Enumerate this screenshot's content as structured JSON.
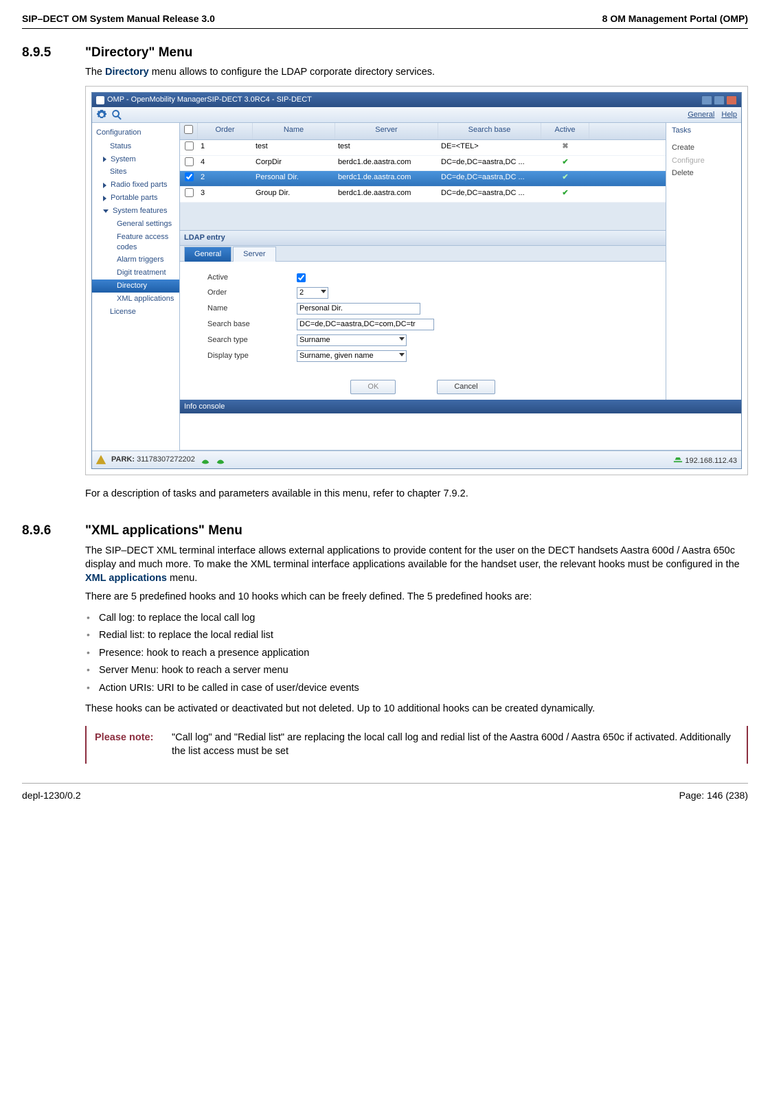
{
  "header": {
    "left": "SIP–DECT OM System Manual Release 3.0",
    "right": "8 OM Management Portal (OMP)"
  },
  "sec1": {
    "num": "8.9.5",
    "title": "\"Directory\" Menu",
    "intro_pre": "The ",
    "intro_bold": "Directory",
    "intro_post": " menu allows to configure the LDAP corporate directory services.",
    "after": "For a description of tasks and parameters available in this menu, refer to chapter 7.9.2."
  },
  "omp": {
    "title": "OMP - OpenMobility ManagerSIP-DECT 3.0RC4 - SIP-DECT",
    "toolbar": {
      "general": "General",
      "help": "Help"
    },
    "sidebar": {
      "root": "Configuration",
      "items": [
        "Status",
        "System",
        "Sites",
        "Radio fixed parts",
        "Portable parts",
        "System features"
      ],
      "features": [
        "General settings",
        "Feature access codes",
        "Alarm triggers",
        "Digit treatment",
        "Directory",
        "XML applications"
      ],
      "last": "License"
    },
    "columns": {
      "order": "Order",
      "name": "Name",
      "server": "Server",
      "searchbase": "Search base",
      "active": "Active"
    },
    "rows": [
      {
        "chk": false,
        "order": "1",
        "name": "test",
        "server": "test",
        "sb": "DE=<TEL>",
        "active": "x"
      },
      {
        "chk": false,
        "order": "4",
        "name": "CorpDir",
        "server": "berdc1.de.aastra.com",
        "sb": "DC=de,DC=aastra,DC ...",
        "active": "✓"
      },
      {
        "chk": true,
        "order": "2",
        "name": "Personal Dir.",
        "server": "berdc1.de.aastra.com",
        "sb": "DC=de,DC=aastra,DC ...",
        "active": "✓",
        "selected": true
      },
      {
        "chk": false,
        "order": "3",
        "name": "Group Dir.",
        "server": "berdc1.de.aastra.com",
        "sb": "DC=de,DC=aastra,DC ...",
        "active": "✓"
      }
    ],
    "tasks": {
      "title": "Tasks",
      "create": "Create",
      "configure": "Configure",
      "delete": "Delete"
    },
    "ldap": {
      "heading": "LDAP entry",
      "tabs": {
        "general": "General",
        "server": "Server"
      },
      "labels": {
        "active": "Active",
        "order": "Order",
        "name": "Name",
        "searchbase": "Search base",
        "searchtype": "Search type",
        "displaytype": "Display type"
      },
      "values": {
        "order": "2",
        "name": "Personal Dir.",
        "searchbase": "DC=de,DC=aastra,DC=com,DC=tr",
        "searchtype": "Surname",
        "displaytype": "Surname, given name"
      },
      "buttons": {
        "ok": "OK",
        "cancel": "Cancel"
      }
    },
    "info_console": "Info console",
    "status": {
      "park_label": "PARK:",
      "park": "31178307272202",
      "ip": "192.168.112.43"
    }
  },
  "sec2": {
    "num": "8.9.6",
    "title": "\"XML applications\" Menu",
    "p1_pre": "The SIP–DECT XML terminal interface allows external applications to provide content for the user on the DECT handsets Aastra 600d / Aastra 650c display and much more. To make the XML terminal interface applications available for the handset user, the relevant hooks must be configured in the ",
    "p1_bold": "XML applications",
    "p1_post": " menu.",
    "p2": "There are 5 predefined hooks and 10 hooks which can be freely defined. The 5 predefined hooks are:",
    "bullets": [
      "Call log: to replace the local call log",
      "Redial list: to replace the local redial list",
      "Presence: hook to reach a presence application",
      "Server Menu: hook to reach a server menu",
      "Action URIs: URI to be called in case of user/device events"
    ],
    "p3": "These hooks can be activated or deactivated but not deleted. Up to 10 additional hooks can be created dynamically.",
    "note_label": "Please note:",
    "note_text": "\"Call log\" and \"Redial list\" are replacing the local call log and redial list of the Aastra 600d / Aastra 650c if activated. Additionally the list access must be set"
  },
  "footer": {
    "left": "depl-1230/0.2",
    "right": "Page: 146 (238)"
  }
}
